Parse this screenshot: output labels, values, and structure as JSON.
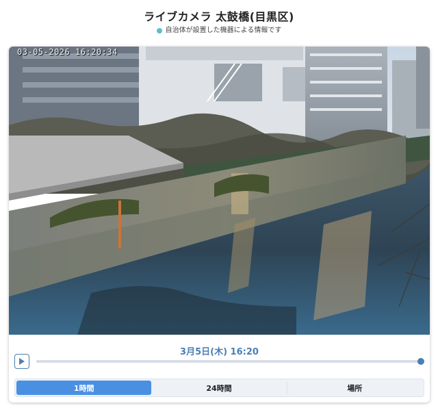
{
  "header": {
    "title": "ライブカメラ 太鼓橋(目黒区)",
    "subtitle": "自治体が設置した機器による情報です",
    "dot_color": "#5bc0c8"
  },
  "camera": {
    "timestamp": "03-05-2026 16:20:34"
  },
  "player": {
    "time_label": "3月5日(木) 16:20",
    "progress": 1.0,
    "accent_color": "#4a7fb5"
  },
  "tabs": [
    {
      "label": "1時間",
      "active": true
    },
    {
      "label": "24時間",
      "active": false
    },
    {
      "label": "場所",
      "active": false
    }
  ]
}
